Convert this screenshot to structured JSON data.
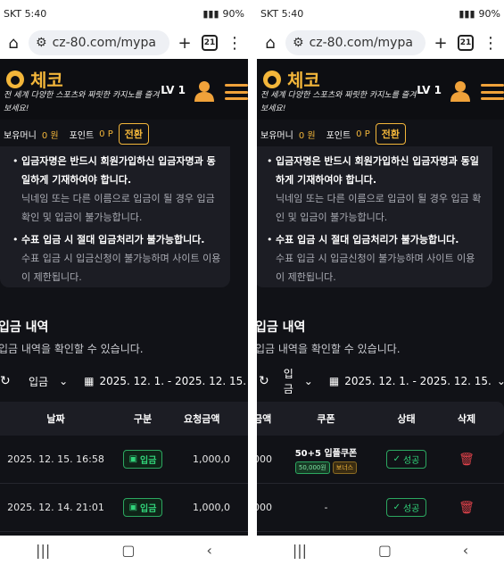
{
  "left": {
    "status": {
      "carrier": "SKT",
      "time": "5:40",
      "battery": "90%"
    },
    "url": "cz-80.com/mypa",
    "tab_count": "21"
  },
  "right": {
    "status": {
      "carrier": "SKT",
      "time": "5:40",
      "battery": "90%"
    },
    "url": "cz-80.com/mypa",
    "tab_count": "21"
  },
  "site": {
    "logo_text": "체코",
    "tagline": "전 세계 다양한 스포츠와 짜릿한 카지노를 즐겨보세요!",
    "level": "LV 1",
    "money_label": "보유머니",
    "money_value": "0 원",
    "point_label": "포인트",
    "point_value": "0 P",
    "switch_label": "전환"
  },
  "notice": {
    "left_item1_bold": "입금자명은 반드시 회원가입하신 입금자명과 동일하게 기재하여야 합니다.",
    "left_item1_sub": "닉네임 또는 다른 이름으로 입금이 될 경우 입금확인 및 입금이 불가능합니다.",
    "left_item2_bold": "수표 입금 시 절대 입금처리가 불가능합니다.",
    "left_item2_sub": "수표 입금 시 입금신청이 불가능하며 사이트 이용이 제한됩니다.",
    "right_item1_bold": "입금자명은 반드시 회원가입하신 입금자명과 동일하게 기재하여야 합니다.",
    "right_item1_sub": "닉네임 또는 다른 이름으로 입금이 될 경우 입금 확인 및 입금이 불가능합니다.",
    "right_item2_bold": "수표 입금 시 절대 입금처리가 불가능합니다.",
    "right_item2_sub": "수표 입금 시 입금신청이 불가능하며 사이트 이용이 제한됩니다."
  },
  "history": {
    "title": "입금 내역",
    "desc": "입금 내역을 확인할 수 있습니다.",
    "type_filter": "입금",
    "date_range": "2025. 12. 1. - 2025. 12. 15."
  },
  "table": {
    "col_date": "날짜",
    "col_type": "구분",
    "col_amount_left": "요청금액",
    "col_amount_right": "금액",
    "col_coupon": "쿠폰",
    "col_status": "상태",
    "col_delete": "삭제",
    "rows": [
      {
        "date": "2025. 12. 15. 16:58",
        "type": "입금",
        "amount": "1,000,0",
        "amount_tail": "000",
        "coupon_name": "50+5 입플쿠폰",
        "coupon_amount": "50,000원",
        "coupon_tag": "보너스",
        "status": "성공"
      },
      {
        "date": "2025. 12. 14. 21:01",
        "type": "입금",
        "amount": "1,000,0",
        "amount_tail": "000",
        "coupon_name": "-",
        "status": "성공"
      }
    ]
  },
  "colors": {
    "accent": "#f3b63a",
    "success": "#31d47a",
    "danger": "#e2434b",
    "bg": "#111217"
  }
}
